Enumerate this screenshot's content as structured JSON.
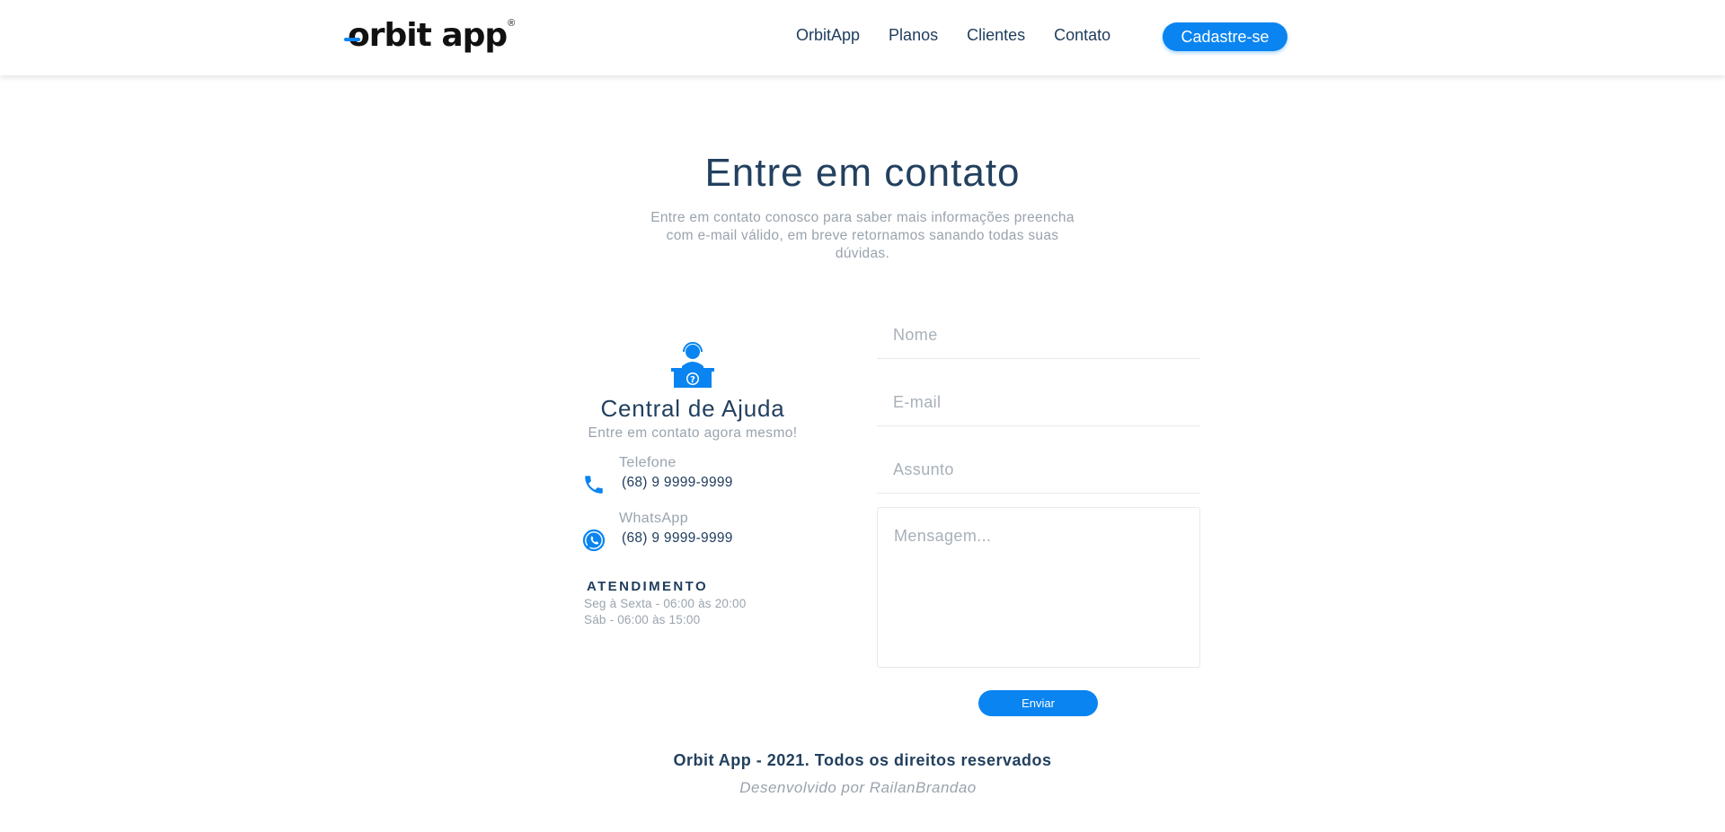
{
  "header": {
    "logo_text": "orbit app",
    "logo_reg": "®",
    "nav": [
      "OrbitApp",
      "Planos",
      "Clientes",
      "Contato"
    ],
    "signup_label": "Cadastre-se"
  },
  "hero": {
    "title": "Entre em contato",
    "subtitle": "Entre em contato conosco para saber mais informações preencha com e-mail válido, em breve retornamos sanando todas suas dúvidas."
  },
  "help": {
    "title": "Central de Ajuda",
    "subtitle": "Entre em contato agora mesmo!",
    "contacts": [
      {
        "label": "Telefone",
        "value": "(68) 9 9999-9999",
        "icon": "phone-icon"
      },
      {
        "label": "WhatsApp",
        "value": "(68) 9 9999-9999",
        "icon": "whatsapp-icon"
      }
    ],
    "hours_title": "ATENDIMENTO",
    "hours": [
      "Seg à Sexta - 06:00 às 20:00",
      "Sáb - 06:00 às 15:00"
    ]
  },
  "form": {
    "name_placeholder": "Nome",
    "email_placeholder": "E-mail",
    "subject_placeholder": "Assunto",
    "message_placeholder": "Mensagem...",
    "send_label": "Enviar"
  },
  "footer": {
    "copyright": "Orbit App - 2021. Todos os direitos reservados",
    "credit": "Desenvolvido por RailanBrandao"
  },
  "colors": {
    "accent": "#0a84f0",
    "heading": "#22405f",
    "muted": "#9aa3ad"
  }
}
